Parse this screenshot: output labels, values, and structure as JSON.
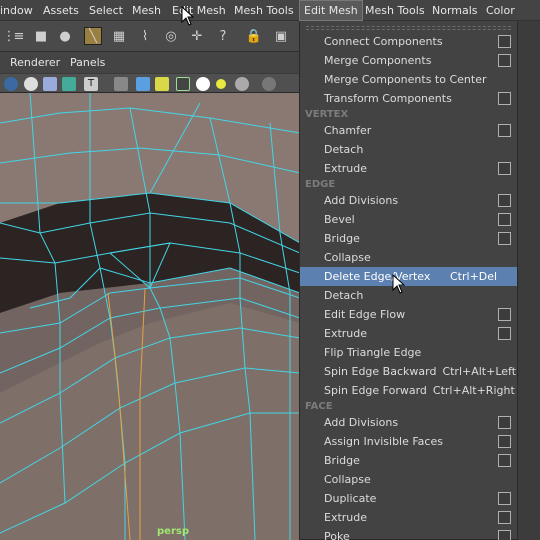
{
  "menubar": {
    "items": [
      {
        "label": "indow",
        "x": "0"
      },
      {
        "label": "Assets",
        "x": "0"
      },
      {
        "label": "Select",
        "x": "0"
      },
      {
        "label": "Mesh",
        "x": "0"
      },
      {
        "label": "Edit Mesh",
        "x": "0"
      },
      {
        "label": "Mesh Tools",
        "x": "0"
      },
      {
        "label": "Edit Mesh",
        "x": "0"
      },
      {
        "label": "Mesh Tools",
        "x": "0"
      },
      {
        "label": "Normals",
        "x": "0"
      },
      {
        "label": "Color",
        "x": "0"
      }
    ]
  },
  "panel_menu": {
    "renderer": "Renderer",
    "panels": "Panels"
  },
  "viewport": {
    "camera_label": "persp",
    "mesh_fill": "#6e625d",
    "wire_color": "#42d6e6",
    "edge_highlight": "#e8a040"
  },
  "edit_mesh_menu": {
    "components": [
      {
        "label": "Connect Components",
        "option_box": true
      },
      {
        "label": "Merge Components",
        "option_box": true
      },
      {
        "label": "Merge Components to Center",
        "option_box": false
      },
      {
        "label": "Transform Components",
        "option_box": true
      }
    ],
    "vertex_header": "VERTEX",
    "vertex": [
      {
        "label": "Chamfer",
        "option_box": true
      },
      {
        "label": "Detach",
        "option_box": false
      },
      {
        "label": "Extrude",
        "option_box": true
      }
    ],
    "edge_header": "EDGE",
    "edge": [
      {
        "label": "Add Divisions",
        "option_box": true
      },
      {
        "label": "Bevel",
        "option_box": true
      },
      {
        "label": "Bridge",
        "option_box": true
      },
      {
        "label": "Collapse",
        "option_box": false
      },
      {
        "label": "Delete Edge/Vertex",
        "shortcut": "Ctrl+Del",
        "highlighted": true
      },
      {
        "label": "Detach",
        "option_box": false
      },
      {
        "label": "Edit Edge Flow",
        "option_box": true
      },
      {
        "label": "Extrude",
        "option_box": true
      },
      {
        "label": "Flip Triangle Edge",
        "option_box": false
      },
      {
        "label": "Spin Edge Backward",
        "shortcut": "Ctrl+Alt+Left"
      },
      {
        "label": "Spin Edge Forward",
        "shortcut": "Ctrl+Alt+Right"
      }
    ],
    "face_header": "FACE",
    "face": [
      {
        "label": "Add Divisions",
        "option_box": true
      },
      {
        "label": "Assign Invisible Faces",
        "option_box": true
      },
      {
        "label": "Bridge",
        "option_box": true
      },
      {
        "label": "Collapse",
        "option_box": false
      },
      {
        "label": "Duplicate",
        "option_box": true
      },
      {
        "label": "Extrude",
        "option_box": true
      },
      {
        "label": "Poke",
        "option_box": true
      }
    ]
  },
  "colors": {
    "highlight": "#5c80b0",
    "menu_bg": "#434343",
    "section_text": "#7c7c7c"
  }
}
